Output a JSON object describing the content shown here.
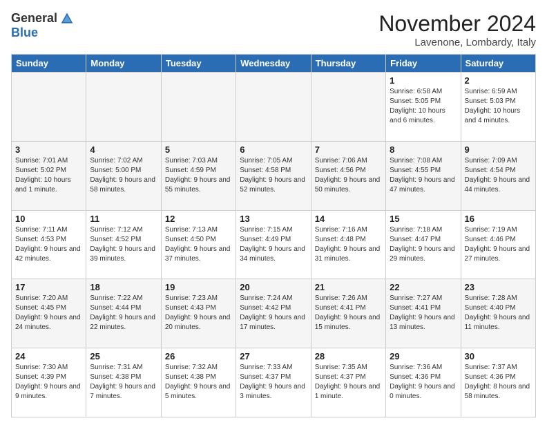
{
  "header": {
    "logo_general": "General",
    "logo_blue": "Blue",
    "month_title": "November 2024",
    "subtitle": "Lavenone, Lombardy, Italy"
  },
  "weekdays": [
    "Sunday",
    "Monday",
    "Tuesday",
    "Wednesday",
    "Thursday",
    "Friday",
    "Saturday"
  ],
  "weeks": [
    {
      "days": [
        {
          "num": "",
          "info": ""
        },
        {
          "num": "",
          "info": ""
        },
        {
          "num": "",
          "info": ""
        },
        {
          "num": "",
          "info": ""
        },
        {
          "num": "",
          "info": ""
        },
        {
          "num": "1",
          "info": "Sunrise: 6:58 AM\nSunset: 5:05 PM\nDaylight: 10 hours and 6 minutes."
        },
        {
          "num": "2",
          "info": "Sunrise: 6:59 AM\nSunset: 5:03 PM\nDaylight: 10 hours and 4 minutes."
        }
      ]
    },
    {
      "days": [
        {
          "num": "3",
          "info": "Sunrise: 7:01 AM\nSunset: 5:02 PM\nDaylight: 10 hours and 1 minute."
        },
        {
          "num": "4",
          "info": "Sunrise: 7:02 AM\nSunset: 5:00 PM\nDaylight: 9 hours and 58 minutes."
        },
        {
          "num": "5",
          "info": "Sunrise: 7:03 AM\nSunset: 4:59 PM\nDaylight: 9 hours and 55 minutes."
        },
        {
          "num": "6",
          "info": "Sunrise: 7:05 AM\nSunset: 4:58 PM\nDaylight: 9 hours and 52 minutes."
        },
        {
          "num": "7",
          "info": "Sunrise: 7:06 AM\nSunset: 4:56 PM\nDaylight: 9 hours and 50 minutes."
        },
        {
          "num": "8",
          "info": "Sunrise: 7:08 AM\nSunset: 4:55 PM\nDaylight: 9 hours and 47 minutes."
        },
        {
          "num": "9",
          "info": "Sunrise: 7:09 AM\nSunset: 4:54 PM\nDaylight: 9 hours and 44 minutes."
        }
      ]
    },
    {
      "days": [
        {
          "num": "10",
          "info": "Sunrise: 7:11 AM\nSunset: 4:53 PM\nDaylight: 9 hours and 42 minutes."
        },
        {
          "num": "11",
          "info": "Sunrise: 7:12 AM\nSunset: 4:52 PM\nDaylight: 9 hours and 39 minutes."
        },
        {
          "num": "12",
          "info": "Sunrise: 7:13 AM\nSunset: 4:50 PM\nDaylight: 9 hours and 37 minutes."
        },
        {
          "num": "13",
          "info": "Sunrise: 7:15 AM\nSunset: 4:49 PM\nDaylight: 9 hours and 34 minutes."
        },
        {
          "num": "14",
          "info": "Sunrise: 7:16 AM\nSunset: 4:48 PM\nDaylight: 9 hours and 31 minutes."
        },
        {
          "num": "15",
          "info": "Sunrise: 7:18 AM\nSunset: 4:47 PM\nDaylight: 9 hours and 29 minutes."
        },
        {
          "num": "16",
          "info": "Sunrise: 7:19 AM\nSunset: 4:46 PM\nDaylight: 9 hours and 27 minutes."
        }
      ]
    },
    {
      "days": [
        {
          "num": "17",
          "info": "Sunrise: 7:20 AM\nSunset: 4:45 PM\nDaylight: 9 hours and 24 minutes."
        },
        {
          "num": "18",
          "info": "Sunrise: 7:22 AM\nSunset: 4:44 PM\nDaylight: 9 hours and 22 minutes."
        },
        {
          "num": "19",
          "info": "Sunrise: 7:23 AM\nSunset: 4:43 PM\nDaylight: 9 hours and 20 minutes."
        },
        {
          "num": "20",
          "info": "Sunrise: 7:24 AM\nSunset: 4:42 PM\nDaylight: 9 hours and 17 minutes."
        },
        {
          "num": "21",
          "info": "Sunrise: 7:26 AM\nSunset: 4:41 PM\nDaylight: 9 hours and 15 minutes."
        },
        {
          "num": "22",
          "info": "Sunrise: 7:27 AM\nSunset: 4:41 PM\nDaylight: 9 hours and 13 minutes."
        },
        {
          "num": "23",
          "info": "Sunrise: 7:28 AM\nSunset: 4:40 PM\nDaylight: 9 hours and 11 minutes."
        }
      ]
    },
    {
      "days": [
        {
          "num": "24",
          "info": "Sunrise: 7:30 AM\nSunset: 4:39 PM\nDaylight: 9 hours and 9 minutes."
        },
        {
          "num": "25",
          "info": "Sunrise: 7:31 AM\nSunset: 4:38 PM\nDaylight: 9 hours and 7 minutes."
        },
        {
          "num": "26",
          "info": "Sunrise: 7:32 AM\nSunset: 4:38 PM\nDaylight: 9 hours and 5 minutes."
        },
        {
          "num": "27",
          "info": "Sunrise: 7:33 AM\nSunset: 4:37 PM\nDaylight: 9 hours and 3 minutes."
        },
        {
          "num": "28",
          "info": "Sunrise: 7:35 AM\nSunset: 4:37 PM\nDaylight: 9 hours and 1 minute."
        },
        {
          "num": "29",
          "info": "Sunrise: 7:36 AM\nSunset: 4:36 PM\nDaylight: 9 hours and 0 minutes."
        },
        {
          "num": "30",
          "info": "Sunrise: 7:37 AM\nSunset: 4:36 PM\nDaylight: 8 hours and 58 minutes."
        }
      ]
    }
  ]
}
